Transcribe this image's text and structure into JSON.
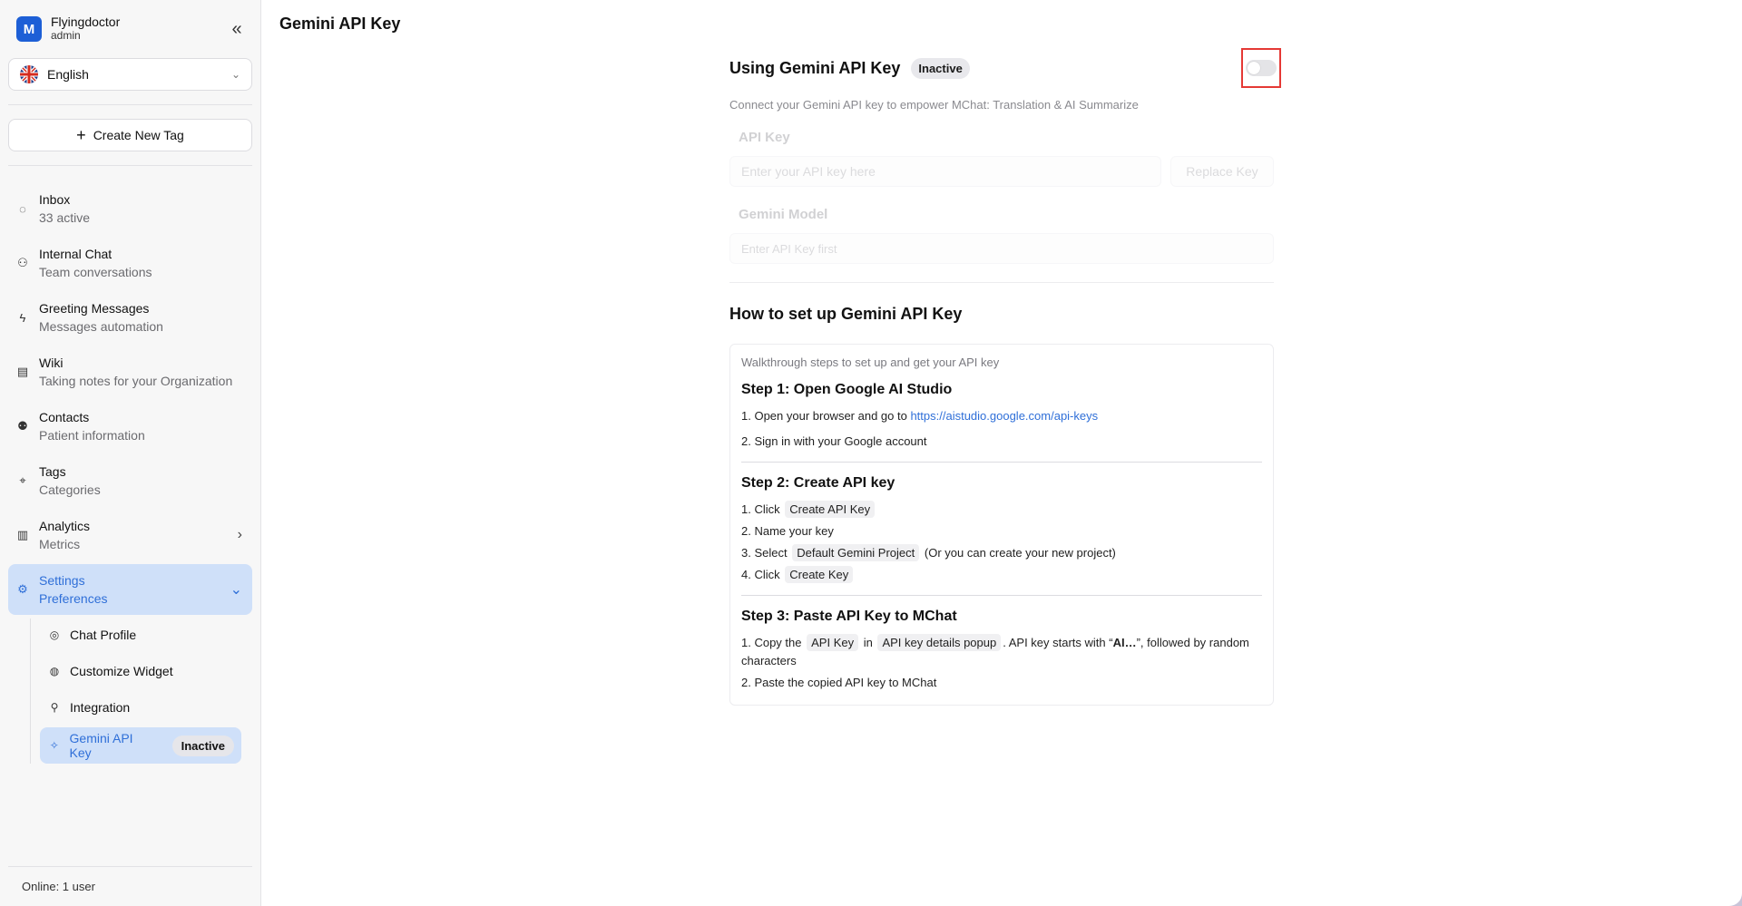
{
  "org": {
    "logo_letter": "M",
    "name": "Flyingdoctor",
    "role": "admin"
  },
  "language": {
    "selected": "English"
  },
  "create_tag_label": "Create New Tag",
  "nav": [
    {
      "title": "Inbox",
      "sub": "33 active",
      "icon": "chat-bubble-icon"
    },
    {
      "title": "Internal Chat",
      "sub": "Team conversations",
      "icon": "team-icon"
    },
    {
      "title": "Greeting Messages",
      "sub": "Messages automation",
      "icon": "lightning-icon"
    },
    {
      "title": "Wiki",
      "sub": "Taking notes for your Organization",
      "icon": "notebook-icon"
    },
    {
      "title": "Contacts",
      "sub": "Patient information",
      "icon": "contacts-icon"
    },
    {
      "title": "Tags",
      "sub": "Categories",
      "icon": "tag-icon"
    },
    {
      "title": "Analytics",
      "sub": "Metrics",
      "icon": "bar-chart-icon"
    },
    {
      "title": "Settings",
      "sub": "Preferences",
      "icon": "gear-icon"
    }
  ],
  "settings_sub": [
    {
      "label": "Chat Profile",
      "icon": "user-circle-icon"
    },
    {
      "label": "Customize Widget",
      "icon": "palette-icon"
    },
    {
      "label": "Integration",
      "icon": "plug-icon"
    },
    {
      "label": "Gemini API Key",
      "icon": "sparkle-icon",
      "badge": "Inactive"
    }
  ],
  "online_text": "Online:  1 user",
  "page_title": "Gemini API Key",
  "using": {
    "title": "Using Gemini API Key",
    "status": "Inactive",
    "enabled": false
  },
  "description": "Connect your Gemini API key to empower MChat: Translation & AI Summarize",
  "api_key": {
    "label": "API Key",
    "placeholder": "Enter your API key here",
    "replace_label": "Replace Key"
  },
  "model": {
    "label": "Gemini Model",
    "placeholder": "Enter API Key first"
  },
  "howto": {
    "title": "How to set up Gemini API Key",
    "intro": "Walkthrough steps to set up and get your API key",
    "step1": {
      "title": "Step 1: Open Google AI Studio",
      "line1_prefix": "1. Open your browser and go to ",
      "link": "https://aistudio.google.com/api-keys",
      "line2": "2. Sign in with your Google account"
    },
    "step2": {
      "title": "Step 2: Create API key",
      "l1_prefix": "1. Click",
      "l1_code": "Create API Key",
      "l2": "2. Name your key",
      "l3_prefix": "3. Select",
      "l3_code": "Default Gemini Project",
      "l3_suffix": "(Or you can create your new project)",
      "l4_prefix": "4. Click",
      "l4_code": "Create Key"
    },
    "step3": {
      "title": "Step 3: Paste API Key to MChat",
      "l1_prefix": "1. Copy the",
      "l1_code1": "API Key",
      "l1_mid": "in",
      "l1_code2": "API key details popup",
      "l1_suffix_a": ". API key starts with “",
      "l1_bold": "AI…",
      "l1_suffix_b": "”, followed by random characters",
      "l2": "2. Paste the copied API key to MChat"
    }
  }
}
